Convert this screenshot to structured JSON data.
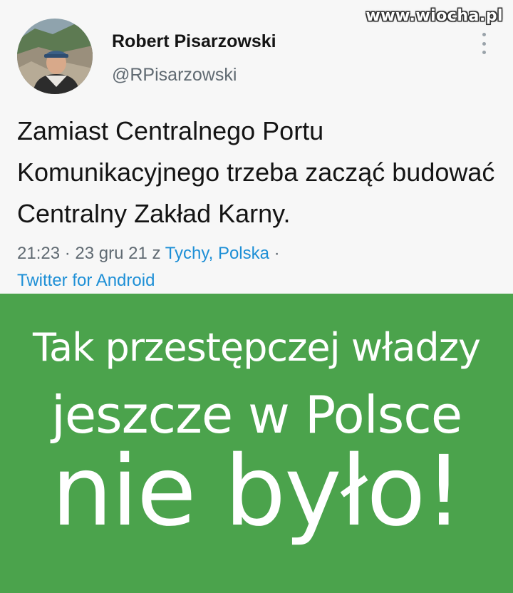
{
  "watermark": "www.wiocha.pl",
  "tweet": {
    "author": {
      "display_name": "Robert Pisarzowski",
      "handle": "@RPisarzowski",
      "avatar_icon": "profile-photo"
    },
    "more_icon": "vertical-ellipsis-icon",
    "text": "Zamiast Centralnego Portu Komunikacyjnego trzeba zacząć budować Centralny Zakład Karny.",
    "meta": {
      "time_date": "21:23 · 23 gru 21 z ",
      "location": "Tychy, Polska",
      "separator": " ·",
      "source": "Twitter for Android"
    }
  },
  "banner": {
    "background_color": "#4ba34c",
    "line1": "Tak przestępczej władzy",
    "line2": "jeszcze w Polsce",
    "line3": "nie było!"
  },
  "colors": {
    "link": "#1d8fd6",
    "text": "#141414",
    "muted": "#606a72"
  }
}
